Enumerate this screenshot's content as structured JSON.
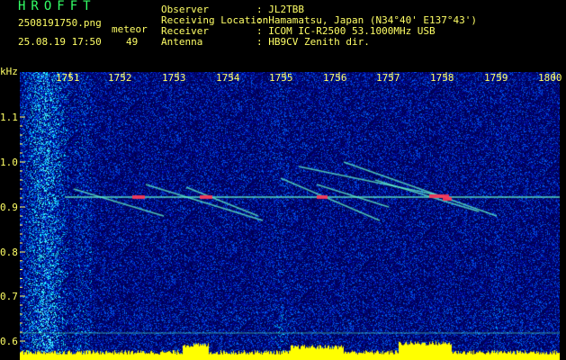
{
  "header": {
    "brand": "HROFFT",
    "filename": "2508191750.png",
    "datetime": "25.08.19 17:50",
    "meteor_label": "meteor",
    "meteor_count": "49",
    "observer_label": "Observer",
    "observer_value": ": JL2TBB",
    "location_label": "Receiving Location",
    "location_value": ": Hamamatsu, Japan (N34°40' E137°43')",
    "receiver_label": "Receiver",
    "receiver_value": ": ICOM IC-R2500 53.1000MHz USB",
    "antenna_label": "Antenna",
    "antenna_value": ": HB9CV Zenith dir."
  },
  "axes": {
    "y_unit": "kHz",
    "x_ticks": [
      "1751",
      "1752",
      "1753",
      "1754",
      "1755",
      "1756",
      "1757",
      "1758",
      "1759",
      "1800"
    ],
    "y_ticks": [
      "1.1",
      "1.0",
      "0.9",
      "0.8",
      "0.7",
      "0.6"
    ]
  },
  "colors": {
    "background": "#000000",
    "label_yellow": "#ffff66",
    "brand_green": "#33ff66",
    "carrier_line": "#66ffcc",
    "meteor_trail": "#ff3355",
    "signal_bar": "#ffff00"
  }
}
